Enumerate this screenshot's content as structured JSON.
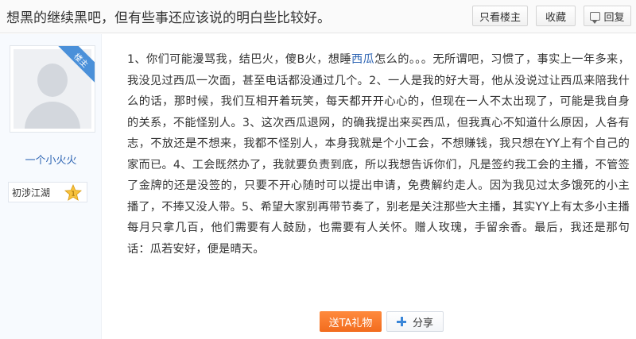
{
  "post": {
    "title": "想黑的继续黑吧，但有些事还应该说的明白些比较好。"
  },
  "toolbar": {
    "only_op_label": "只看楼主",
    "collect_label": "收藏",
    "reply_label": "回复"
  },
  "author": {
    "op_badge": "楼主",
    "name": "一个小火火",
    "level_name": "初涉江湖",
    "level_icon": "star-badge-icon"
  },
  "content": {
    "text_before": "1、你们可能漫骂我，结巴火，傻B火，想睡",
    "link": "西瓜",
    "text_after": "怎么的。。。无所谓吧，习惯了，事实上一年多来，我没见过西瓜一次面，甚至电话都没通过几个。2、一人是我的好大哥，他从没说过让西瓜来陪我什么的话，那时候，我们互相开着玩笑，每天都开开心心的，但现在一人不太出现了，可能是我自身的关系，不能怪别人。3、这次西瓜退网，的确我提出来买西瓜，但我真心不知道什么原因，人各有志，不放还是不想来，我都不怪别人，本身我就是个小工会，不想赚钱，我只想在YY上有个自己的家而已。4、工会既然办了，我就要负责到底，所以我想告诉你们，凡是签约我工会的主播，不管签了金牌的还是没签的，只要不开心随时可以提出申请，免费解约走人。因为我见过太多饿死的小主播了，不捧又没人带。5、希望大家别再带节奏了，别老是关注那些大主播，其实YY上有太多小主播每月只拿几百，他们需要有人鼓励，也需要有人关怀。赠人玫瑰，手留余香。最后，我还是那句话：瓜若安好，便是晴天。"
  },
  "actions": {
    "gift_label": "送TA礼物",
    "share_label": "分享"
  },
  "colors": {
    "link": "#2d64b3",
    "gift": "#f26c1e",
    "op_ribbon": "#4a90d9"
  }
}
